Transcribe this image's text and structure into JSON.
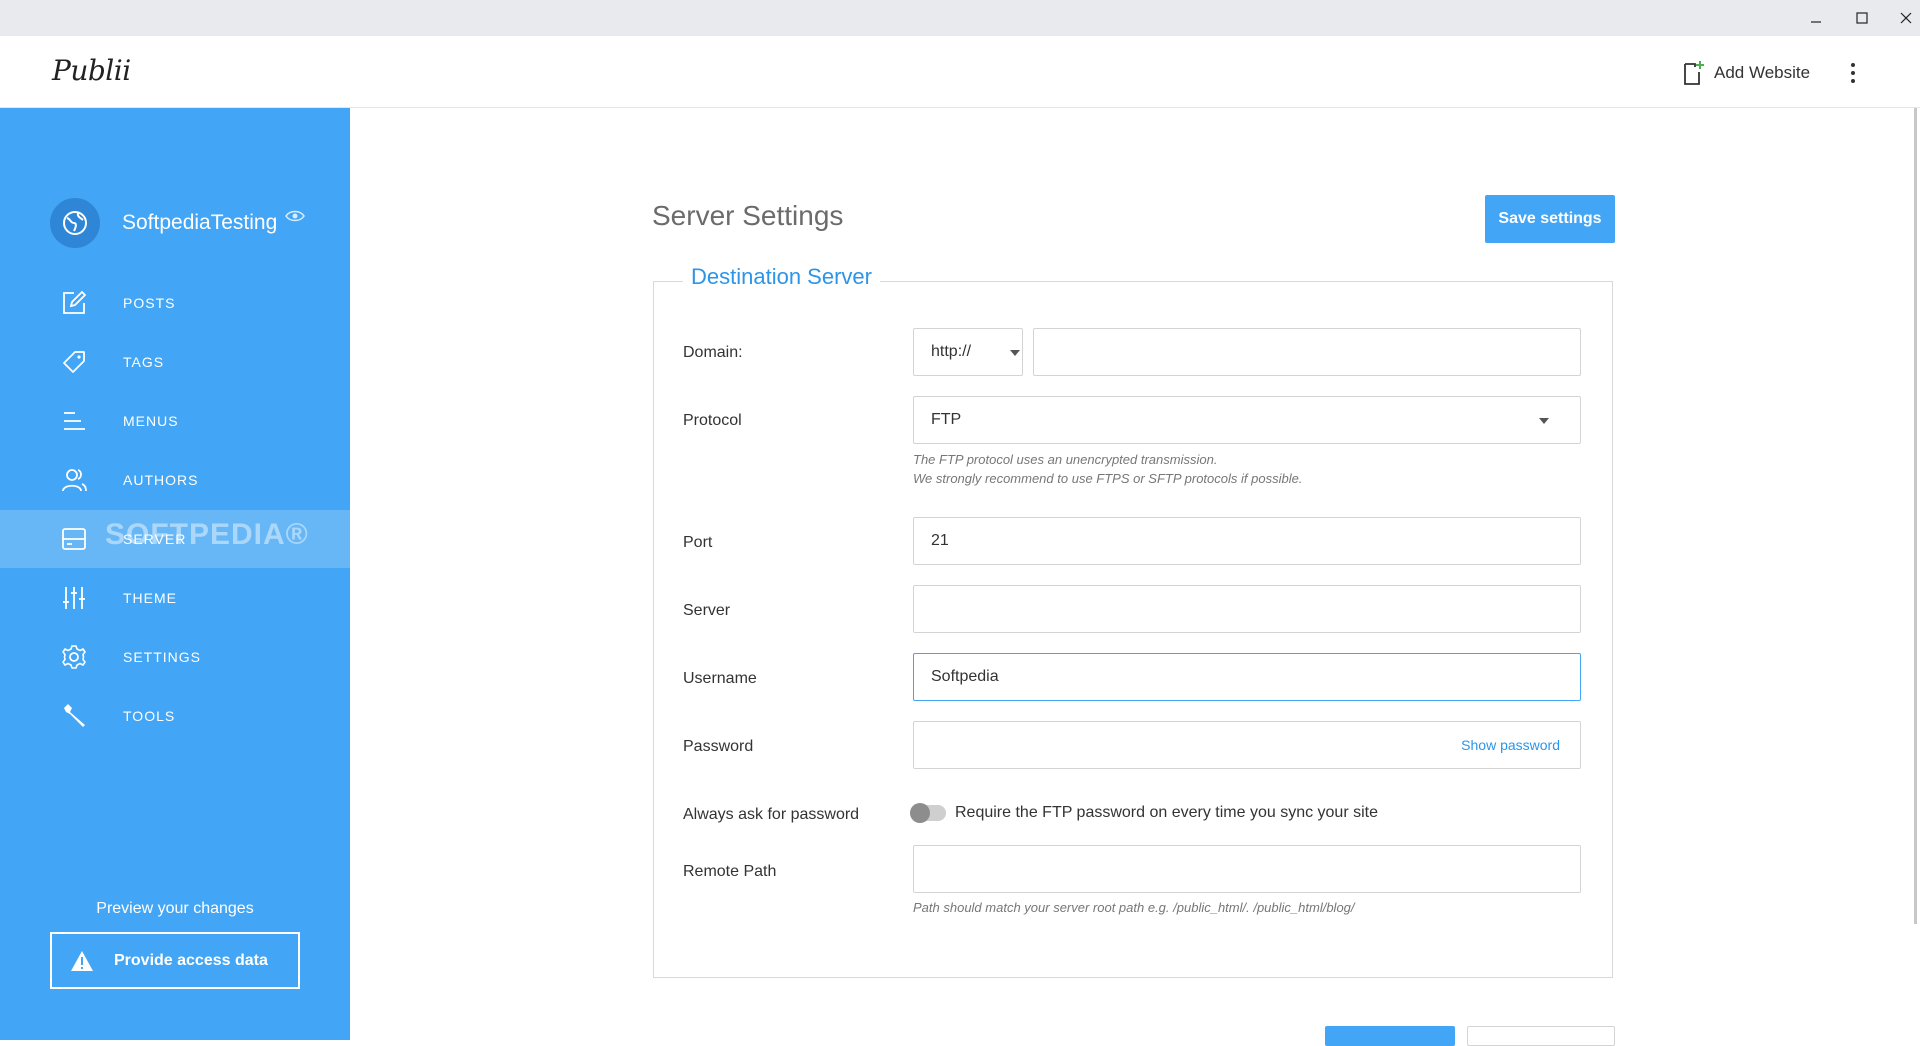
{
  "app": {
    "logo": "Publii"
  },
  "window": {
    "minimize": "—",
    "maximize": "□",
    "close": "✕"
  },
  "header": {
    "add_website": "Add Website"
  },
  "site": {
    "name": "SoftpediaTesting"
  },
  "sidebar": {
    "items": [
      {
        "label": "POSTS",
        "icon": "edit-icon"
      },
      {
        "label": "TAGS",
        "icon": "tag-icon"
      },
      {
        "label": "MENUS",
        "icon": "menu-icon"
      },
      {
        "label": "AUTHORS",
        "icon": "authors-icon"
      },
      {
        "label": "SERVER",
        "icon": "server-icon",
        "active": true
      },
      {
        "label": "THEME",
        "icon": "sliders-icon"
      },
      {
        "label": "SETTINGS",
        "icon": "gear-icon"
      },
      {
        "label": "TOOLS",
        "icon": "wrench-icon"
      }
    ],
    "watermark": "SOFTPEDIA®",
    "preview_text": "Preview your changes",
    "access_button": "Provide access data"
  },
  "main": {
    "title": "Server Settings",
    "save_button": "Save settings",
    "section_title": "Destination Server",
    "fields": {
      "domain_label": "Domain:",
      "domain_protocol": "http://",
      "domain_value": "",
      "protocol_label": "Protocol",
      "protocol_value": "FTP",
      "protocol_help_1": "The FTP protocol uses an unencrypted transmission.",
      "protocol_help_2": "We strongly recommend to use FTPS or SFTP protocols if possible.",
      "port_label": "Port",
      "port_value": "21",
      "server_label": "Server",
      "server_value": "",
      "username_label": "Username",
      "username_value": "Softpedia",
      "password_label": "Password",
      "password_value": "",
      "show_password": "Show password",
      "always_ask_label": "Always ask for password",
      "always_ask_toggle_text": "Require the FTP password on every time you sync your site",
      "always_ask_on": false,
      "remote_path_label": "Remote Path",
      "remote_path_value": "",
      "remote_path_help": "Path should match your server root path e.g. /public_html/. /public_html/blog/"
    }
  },
  "colors": {
    "accent": "#42a5f5",
    "link": "#2c95e8",
    "sidebar": "#42a5f5"
  }
}
